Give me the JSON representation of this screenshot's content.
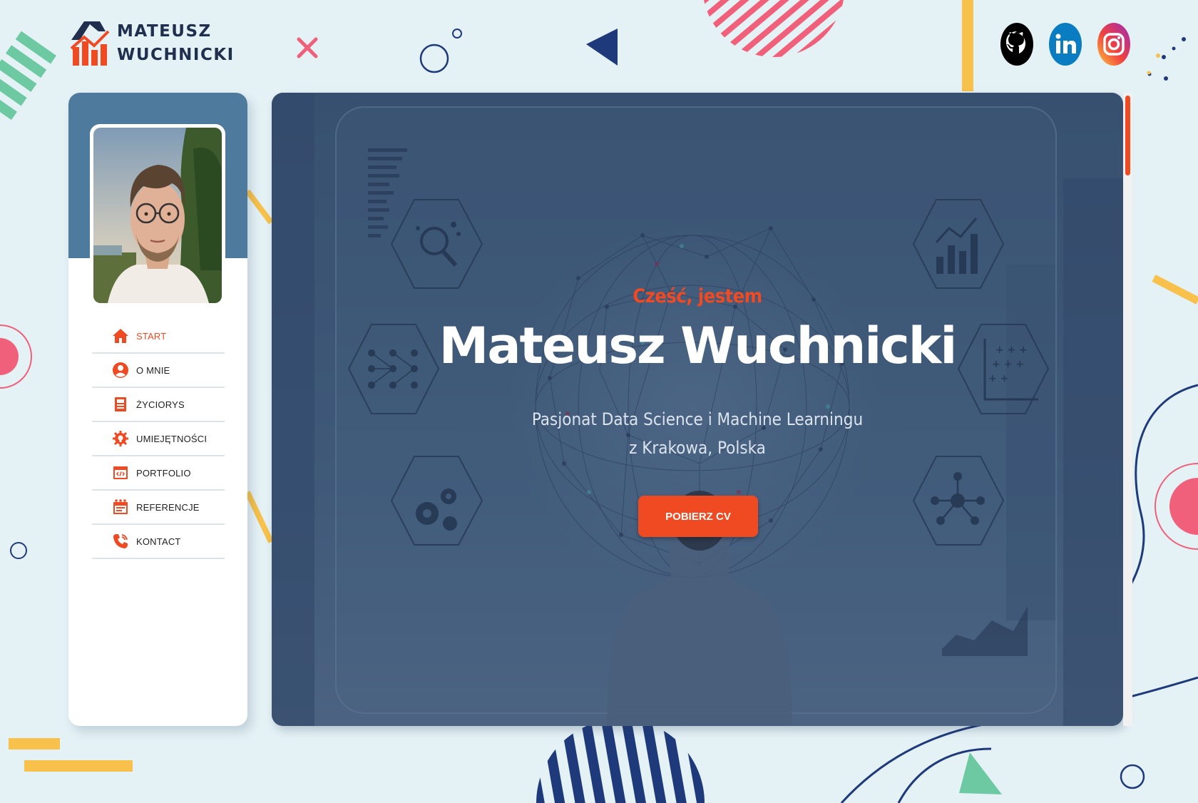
{
  "logo": {
    "line1": "MATEUSZ",
    "line2": "WUCHNICKI",
    "icon": "bar-chart-logo-icon"
  },
  "social": [
    {
      "name": "GitHub",
      "icon": "github-icon"
    },
    {
      "name": "LinkedIn",
      "icon": "linkedin-icon"
    },
    {
      "name": "Instagram",
      "icon": "instagram-icon"
    }
  ],
  "sidebar": {
    "photo_alt": "Mateusz Wuchnicki",
    "items": [
      {
        "label": "START",
        "icon": "home-icon",
        "active": true
      },
      {
        "label": "O MNIE",
        "icon": "user-icon",
        "active": false
      },
      {
        "label": "ŻYCIORYS",
        "icon": "resume-icon",
        "active": false
      },
      {
        "label": "UMIEJĘTNOŚCI",
        "icon": "gear-bulb-icon",
        "active": false
      },
      {
        "label": "PORTFOLIO",
        "icon": "code-window-icon",
        "active": false
      },
      {
        "label": "REFERENCJE",
        "icon": "calendar-icon",
        "active": false
      },
      {
        "label": "KONTACT",
        "icon": "phone-icon",
        "active": false
      }
    ]
  },
  "hero": {
    "greeting": "Cześć, jestem",
    "name": "Mateusz Wuchnicki",
    "tagline_line1": "Pasjonat Data Science i Machine Learningu",
    "tagline_line2": "z Krakowa, Polska",
    "cta_label": "POBIERZ CV"
  },
  "colors": {
    "accent": "#f04a23",
    "navy": "#1f2f4d",
    "sidebar_header": "#4e7a9d",
    "background": "#e4f2f6"
  }
}
